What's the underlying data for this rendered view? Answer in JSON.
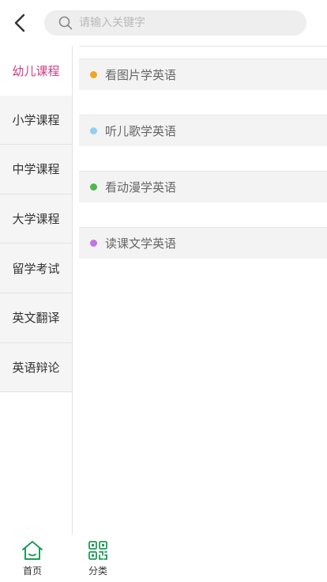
{
  "header": {
    "search_placeholder": "请输入关键字"
  },
  "sidebar": {
    "items": [
      {
        "label": "幼儿课程",
        "active": true
      },
      {
        "label": "小学课程",
        "active": false
      },
      {
        "label": "中学课程",
        "active": false
      },
      {
        "label": "大学课程",
        "active": false
      },
      {
        "label": "留学考试",
        "active": false
      },
      {
        "label": "英文翻译",
        "active": false
      },
      {
        "label": "英语辩论",
        "active": false
      }
    ]
  },
  "content": {
    "items": [
      {
        "label": "看图片学英语",
        "dot_color": "#f0a623"
      },
      {
        "label": "听儿歌学英语",
        "dot_color": "#8fd0f5"
      },
      {
        "label": "看动漫学英语",
        "dot_color": "#4cb94e"
      },
      {
        "label": "读课文学英语",
        "dot_color": "#c572e8"
      }
    ]
  },
  "bottom_nav": {
    "home_label": "首页",
    "category_label": "分类"
  },
  "colors": {
    "accent": "#cc3f84",
    "nav_green": "#1f9a5a"
  }
}
